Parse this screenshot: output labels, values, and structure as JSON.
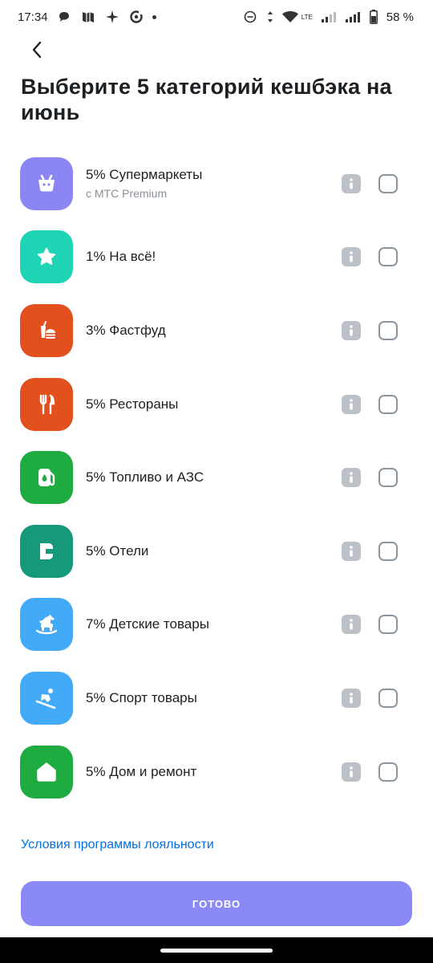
{
  "status_bar": {
    "time": "17:34",
    "battery_percent": "58 %",
    "network": "LTE"
  },
  "header": {
    "title": "Выберите 5 категорий кешбэка на июнь"
  },
  "categories": [
    {
      "label": "5% Супермаркеты",
      "sub": "с МТС Premium",
      "icon": "basket-icon",
      "color": "#8c86f5",
      "checked": false
    },
    {
      "label": "1% На всё!",
      "sub": "",
      "icon": "star-icon",
      "color": "#1ed4b4",
      "checked": false
    },
    {
      "label": "3% Фастфуд",
      "sub": "",
      "icon": "burger-drink-icon",
      "color": "#e2501d",
      "checked": false
    },
    {
      "label": "5% Рестораны",
      "sub": "",
      "icon": "fork-knife-icon",
      "color": "#e2501d",
      "checked": false
    },
    {
      "label": "5% Топливо и АЗС",
      "sub": "",
      "icon": "fuel-pump-icon",
      "color": "#1eab3f",
      "checked": false
    },
    {
      "label": "5% Отели",
      "sub": "",
      "icon": "bed-icon",
      "color": "#15997a",
      "checked": false
    },
    {
      "label": "7% Детские товары",
      "sub": "",
      "icon": "rocking-horse-icon",
      "color": "#42aaf7",
      "checked": false
    },
    {
      "label": "5% Спорт товары",
      "sub": "",
      "icon": "skier-icon",
      "color": "#42aaf7",
      "checked": false
    },
    {
      "label": "5% Дом и ремонт",
      "sub": "",
      "icon": "house-icon",
      "color": "#1eab3f",
      "checked": false
    }
  ],
  "footer": {
    "terms_link": "Условия программы лояльности",
    "ready_button": "ГОТОВО"
  },
  "colors": {
    "accent_button": "#8b88f7",
    "link": "#0070e5",
    "info_badge": "#bbc1c7"
  }
}
